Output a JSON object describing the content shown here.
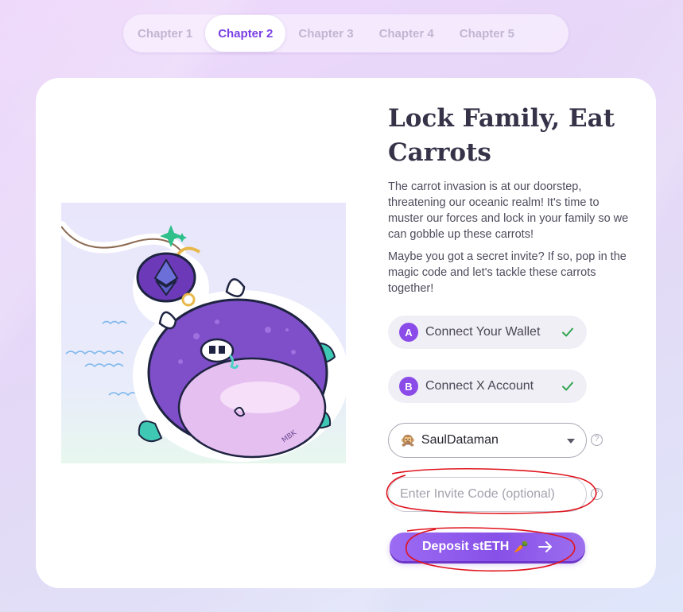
{
  "tabs": [
    {
      "label": "Chapter 1",
      "active": false
    },
    {
      "label": "Chapter 2",
      "active": true
    },
    {
      "label": "Chapter 3",
      "active": false
    },
    {
      "label": "Chapter 4",
      "active": false
    },
    {
      "label": "Chapter 5",
      "active": false
    }
  ],
  "chapter": {
    "title": "Lock Family, Eat Carrots",
    "description_1": "The carrot invasion is at our doorstep, threatening our oceanic realm! It's time to muster our forces and lock in your family so we can gobble up these carrots!",
    "description_2": "Maybe you got a secret invite? If so, pop in the magic code and let's tackle these carrots together!"
  },
  "steps": [
    {
      "badge": "A",
      "label": "Connect Your Wallet",
      "done": true,
      "icon": "check-icon"
    },
    {
      "badge": "B",
      "label": "Connect X Account",
      "done": true,
      "icon": "check-icon"
    }
  ],
  "account_select": {
    "avatar": "🙊",
    "value": "SaulDataman"
  },
  "help_glyph": "?",
  "invite": {
    "placeholder": "Enter Invite Code (optional)",
    "value": ""
  },
  "deposit": {
    "label": "Deposit stETH",
    "emoji": "🥕",
    "icon": "arrow-right-icon"
  },
  "artwork": {
    "signature": "MBK"
  },
  "colors": {
    "accent": "#7a3fe4",
    "button": "#8750e8",
    "check": "#2ea44f",
    "annotation": "#e0141e"
  }
}
